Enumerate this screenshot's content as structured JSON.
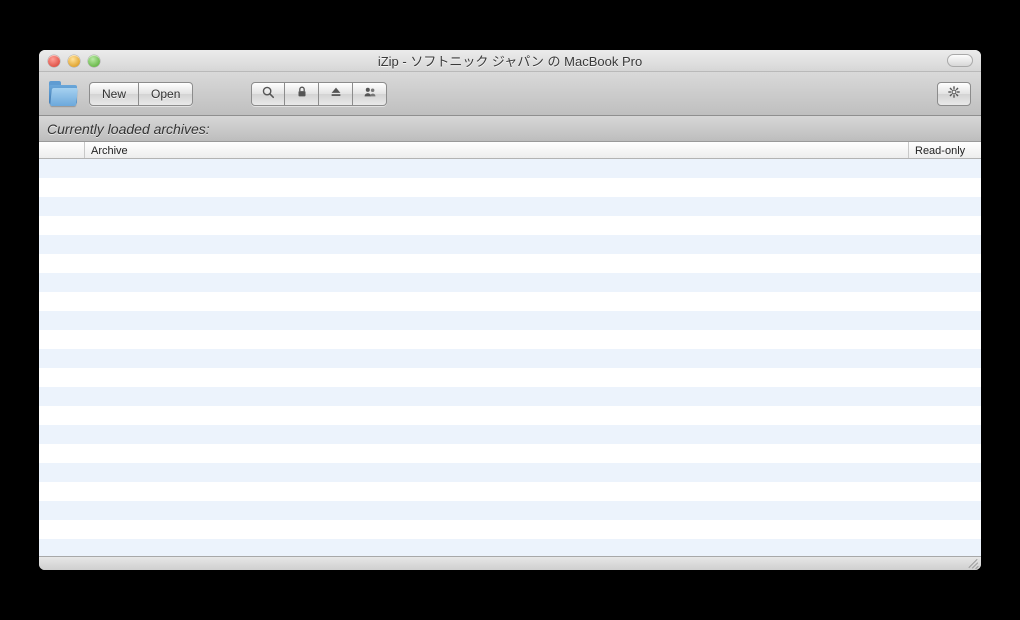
{
  "window": {
    "title": "iZip - ソフトニック ジャパン の MacBook Pro"
  },
  "toolbar": {
    "new_label": "New",
    "open_label": "Open",
    "icons": {
      "search": "search-icon",
      "lock": "lock-icon",
      "eject": "eject-icon",
      "users": "users-icon",
      "gear": "gear-icon",
      "folder": "folder-icon"
    }
  },
  "section": {
    "heading": "Currently loaded archives:"
  },
  "table": {
    "columns": {
      "archive": "Archive",
      "readonly": "Read-only"
    },
    "rows": []
  }
}
